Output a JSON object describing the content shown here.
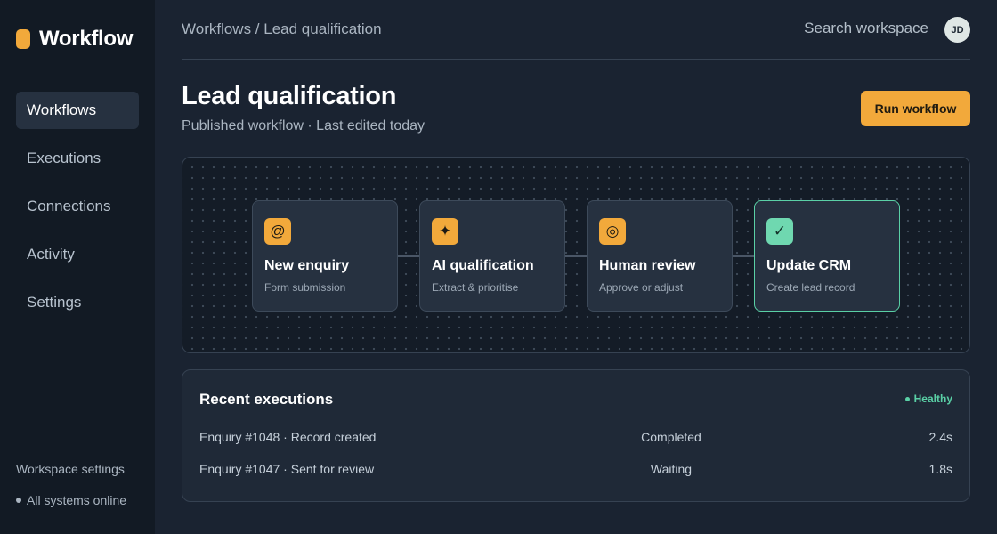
{
  "brand": {
    "name": "Workflow",
    "accent": "#f2a93b"
  },
  "sidebar": {
    "items": [
      {
        "label": "Workflows",
        "active": true
      },
      {
        "label": "Executions",
        "active": false
      },
      {
        "label": "Connections",
        "active": false
      },
      {
        "label": "Activity",
        "active": false
      },
      {
        "label": "Settings",
        "active": false
      }
    ],
    "footer": {
      "settings_link": "Workspace settings",
      "status": "All systems online"
    }
  },
  "header": {
    "breadcrumb": "Workflows / Lead qualification",
    "search_label": "Search workspace",
    "avatar_initials": "JD"
  },
  "page": {
    "title": "Lead qualification",
    "subtitle": "Published workflow · Last edited today",
    "run_button": "Run workflow"
  },
  "workflow": {
    "nodes": [
      {
        "icon": "at-sign-icon",
        "glyph": "@",
        "title": "New enquiry",
        "subtitle": "Form submission"
      },
      {
        "icon": "sparkle-icon",
        "glyph": "✦",
        "title": "AI qualification",
        "subtitle": "Extract & prioritise"
      },
      {
        "icon": "target-icon",
        "glyph": "◎",
        "title": "Human review",
        "subtitle": "Approve or adjust"
      },
      {
        "icon": "check-icon",
        "glyph": "✓",
        "title": "Update CRM",
        "subtitle": "Create lead record"
      }
    ]
  },
  "executions": {
    "title": "Recent executions",
    "health": "Healthy",
    "health_color": "#5ad0a6",
    "rows": [
      {
        "name": "Enquiry #1048 · Record created",
        "status": "Completed",
        "duration": "2.4s"
      },
      {
        "name": "Enquiry #1047 · Sent for review",
        "status": "Waiting",
        "duration": "1.8s"
      }
    ]
  }
}
